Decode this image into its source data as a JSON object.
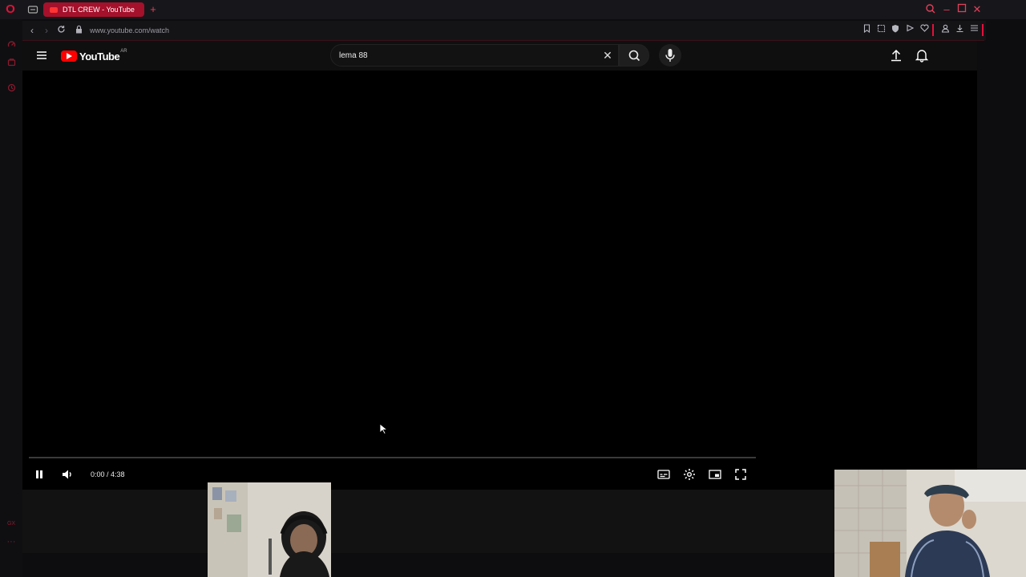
{
  "browser": {
    "tab_title": "DTL CREW - YouTube",
    "url": "www.youtube.com/watch",
    "accent_color": "#e1123a"
  },
  "youtube": {
    "logo_text": "YouTube",
    "country_code": "AR",
    "search_query": "lema 88"
  },
  "player": {
    "time_display": "0:00 / 4:38",
    "progress_fraction": 0.0
  },
  "icons": {
    "opera": "opera-logo",
    "upload": "upload-icon",
    "bell": "bell-icon"
  }
}
